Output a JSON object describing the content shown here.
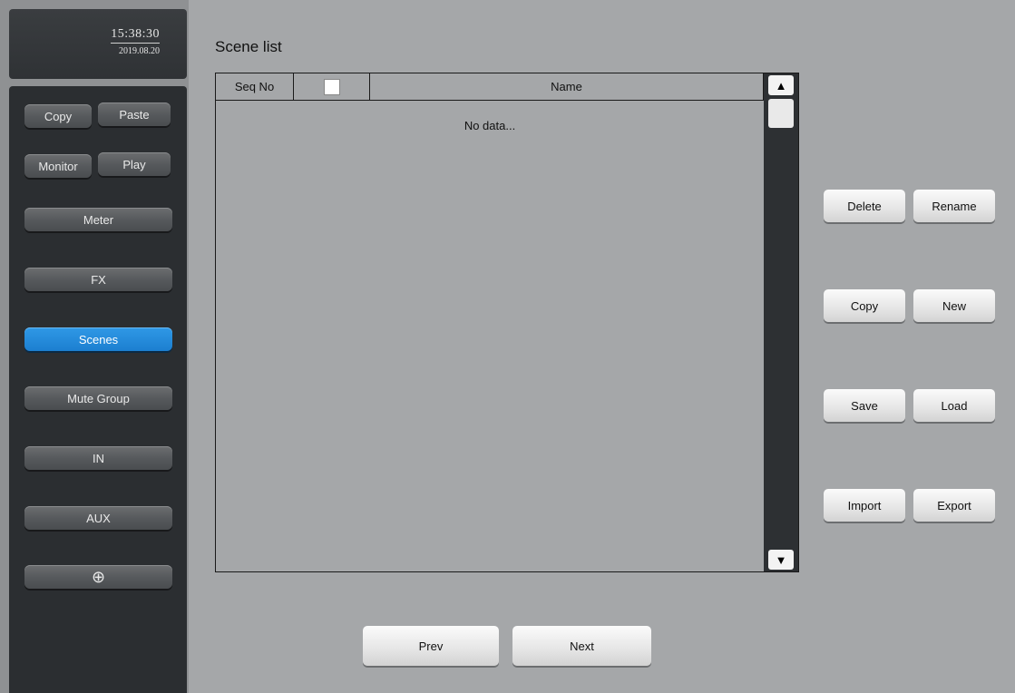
{
  "clock": {
    "time": "15:38:30",
    "date": "2019.08.20"
  },
  "nav": {
    "copy": "Copy",
    "paste": "Paste",
    "monitor": "Monitor",
    "play": "Play",
    "meter": "Meter",
    "fx": "FX",
    "scenes": "Scenes",
    "mute_group": "Mute Group",
    "in": "IN",
    "aux": "AUX",
    "settings_icon": "⊕"
  },
  "scene_list": {
    "title": "Scene list",
    "columns": {
      "seq": "Seq No",
      "name": "Name"
    },
    "empty_text": "No data...",
    "scroll_up": "▲",
    "scroll_down": "▼"
  },
  "actions": {
    "delete": "Delete",
    "rename": "Rename",
    "copy": "Copy",
    "new": "New",
    "save": "Save",
    "load": "Load",
    "import": "Import",
    "export": "Export"
  },
  "paging": {
    "prev": "Prev",
    "next": "Next"
  },
  "colors": {
    "active_nav": "#1c7fd0",
    "panel_dark": "#2b2e31",
    "background": "#a5a7a9"
  }
}
